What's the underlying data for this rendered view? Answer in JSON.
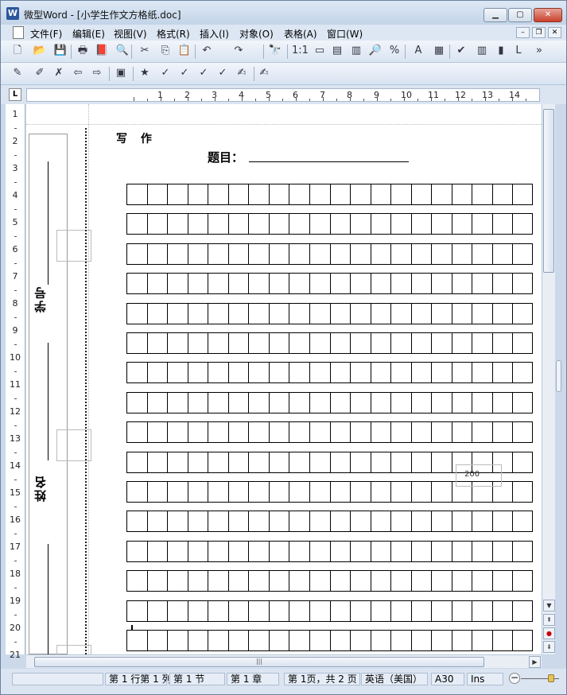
{
  "window": {
    "title": "微型Word - [小学生作文方格纸.doc]",
    "app_icon_letter": "W",
    "min_label": "▁",
    "max_label": "▢",
    "close_label": "✕"
  },
  "menubar": {
    "items": [
      {
        "label": "文件(F)"
      },
      {
        "label": "编辑(E)"
      },
      {
        "label": "视图(V)"
      },
      {
        "label": "格式(R)"
      },
      {
        "label": "插入(I)"
      },
      {
        "label": "对象(O)"
      },
      {
        "label": "表格(A)"
      },
      {
        "label": "窗口(W)"
      }
    ],
    "mdi_min": "–",
    "mdi_restore": "❐",
    "mdi_close": "✕"
  },
  "toolbar1": {
    "items": [
      {
        "name": "new-doc-icon",
        "glyph": "🗋"
      },
      {
        "name": "open-icon",
        "glyph": "📂"
      },
      {
        "name": "save-icon",
        "glyph": "💾"
      },
      {
        "name": "print-icon",
        "glyph": "🖶"
      },
      {
        "name": "pdf-icon",
        "glyph": "📕"
      },
      {
        "name": "print-preview-icon",
        "glyph": "🔍"
      },
      {
        "name": "cut-icon",
        "glyph": "✂"
      },
      {
        "name": "copy-icon",
        "glyph": "⎘"
      },
      {
        "name": "paste-icon",
        "glyph": "📋"
      },
      {
        "name": "undo-icon",
        "glyph": "↶"
      },
      {
        "name": "redo-icon",
        "glyph": "↷"
      },
      {
        "name": "find-icon",
        "glyph": "🔭"
      },
      {
        "name": "actual-size-icon",
        "glyph": "1:1"
      },
      {
        "name": "page-width-icon",
        "glyph": "▭"
      },
      {
        "name": "one-page-icon",
        "glyph": "▤"
      },
      {
        "name": "two-pages-icon",
        "glyph": "▥"
      },
      {
        "name": "zoom-in-icon",
        "glyph": "🔎"
      },
      {
        "name": "zoom-percent-icon",
        "glyph": "%"
      },
      {
        "name": "font-color-icon",
        "glyph": "A"
      },
      {
        "name": "format-icon",
        "glyph": "▦"
      },
      {
        "name": "spellcheck-icon",
        "glyph": "✔"
      },
      {
        "name": "column-icon",
        "glyph": "▥"
      },
      {
        "name": "shading-icon",
        "glyph": "▮"
      },
      {
        "name": "letter-l-icon",
        "glyph": "L"
      },
      {
        "name": "overflow-icon",
        "glyph": "»"
      }
    ]
  },
  "toolbar2": {
    "items": [
      {
        "name": "track-changes-icon",
        "glyph": "✎"
      },
      {
        "name": "edit-note-icon",
        "glyph": "✐"
      },
      {
        "name": "delete-note-icon",
        "glyph": "✗"
      },
      {
        "name": "prev-note-icon",
        "glyph": "⇦"
      },
      {
        "name": "next-note-icon",
        "glyph": "⇨"
      },
      {
        "name": "review-pane-icon",
        "glyph": "▣"
      },
      {
        "name": "accept-icon",
        "glyph": "★"
      },
      {
        "name": "accept-all-icon",
        "glyph": "✓"
      },
      {
        "name": "reject-icon",
        "glyph": "✓"
      },
      {
        "name": "reject-all-icon",
        "glyph": "✓"
      },
      {
        "name": "highlight-icon",
        "glyph": "✓"
      },
      {
        "name": "comment-icon",
        "glyph": "✍"
      },
      {
        "name": "review-icon",
        "glyph": "✍"
      }
    ]
  },
  "ruler": {
    "corner_label": "L",
    "h_numbers": [
      "1",
      "2",
      "3",
      "4",
      "5",
      "6",
      "7",
      "8",
      "9",
      "10",
      "11",
      "12",
      "13",
      "14"
    ],
    "v_numbers": [
      "1",
      "2",
      "3",
      "4",
      "5",
      "6",
      "7",
      "8",
      "9",
      "10",
      "11",
      "12",
      "13",
      "14",
      "15",
      "16",
      "17",
      "18",
      "19",
      "20",
      "21"
    ]
  },
  "document": {
    "heading": "写 作",
    "topic_label": "题目：",
    "student_id_label": "学号",
    "name_label": "姓名",
    "grid_rows": 16,
    "grid_cols": 20,
    "word_count_marker": "200"
  },
  "scrollbar": {
    "up": "▲",
    "down": "▼",
    "prev_page": "⇞",
    "browse_object": "●",
    "next_page": "⇟",
    "left": "◀",
    "right": "▶",
    "grip": "|||"
  },
  "statusbar": {
    "position": "第 1 行第 1 列",
    "section": "第 1 节",
    "chapter": "第 1 章",
    "page": "第 1页，共 2 页",
    "language": "英语（美国）",
    "cell": "A30",
    "mode": "Ins",
    "zoom_minus": "−"
  }
}
